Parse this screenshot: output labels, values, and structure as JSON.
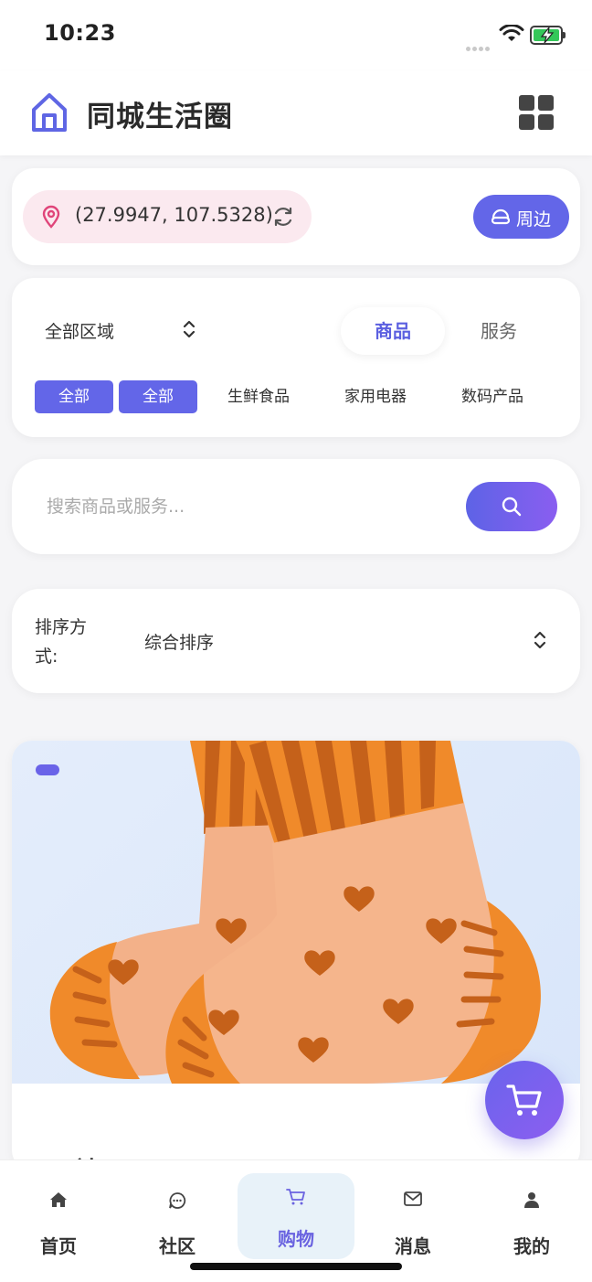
{
  "status_bar": {
    "time": "10:23"
  },
  "header": {
    "title": "同城生活圈",
    "logo_icon": "home-outline-icon",
    "menu_icon": "grid-icon"
  },
  "location": {
    "coords": "(27.9947, 107.5328)",
    "nearby_label": "周边"
  },
  "filters": {
    "region": "全部区域",
    "segments": [
      {
        "label": "商品",
        "active": true
      },
      {
        "label": "服务",
        "active": false
      }
    ],
    "categories": [
      {
        "label": "全部",
        "active": true
      },
      {
        "label": "全部",
        "active": true
      },
      {
        "label": "生鲜食品",
        "active": false
      },
      {
        "label": "家用电器",
        "active": false
      },
      {
        "label": "数码产品",
        "active": false
      }
    ]
  },
  "search": {
    "placeholder": "搜索商品或服务..."
  },
  "sort": {
    "label": "排序方式:",
    "value": "综合排序"
  },
  "product": {
    "name": "袜子"
  },
  "tabbar": {
    "tabs": [
      {
        "label": "首页",
        "icon": "home-icon",
        "active": false
      },
      {
        "label": "社区",
        "icon": "chat-icon",
        "active": false
      },
      {
        "label": "购物",
        "icon": "cart-icon",
        "active": true
      },
      {
        "label": "消息",
        "icon": "mail-icon",
        "active": false
      },
      {
        "label": "我的",
        "icon": "user-icon",
        "active": false
      }
    ]
  },
  "colors": {
    "accent": "#6366e8",
    "accent_text": "#5b5fe0",
    "location_bg": "#fbe9ef",
    "pin": "#e0457a"
  }
}
